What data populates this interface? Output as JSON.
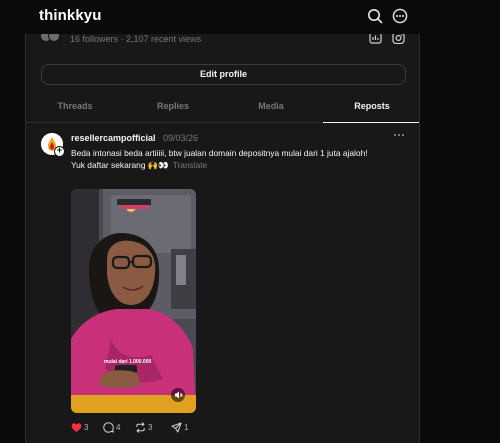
{
  "app": {
    "title": "thinkkyu"
  },
  "header": {
    "icons": [
      "search-icon",
      "more-circle-icon"
    ]
  },
  "profile": {
    "stats_text": "16 followers · 2,107 recent views",
    "edit_profile_label": "Edit profile",
    "social_icons": [
      "instagram-icon",
      "insights-icon"
    ]
  },
  "tabs": [
    {
      "label": "Threads",
      "active": false
    },
    {
      "label": "Replies",
      "active": false
    },
    {
      "label": "Media",
      "active": false
    },
    {
      "label": "Reposts",
      "active": true
    }
  ],
  "post": {
    "username": "resellercampofficial",
    "date": "09/03/26",
    "text_line1": "Beda intonasi beda artiiiii, btw jualan domain depositnya mulai dari 1 juta ajaloh!",
    "text_line2": "Yuk daftar sekarang 🙌👀",
    "translate_label": "Translate",
    "media_caption": "mulai dari 1.000.000",
    "likes": "3",
    "comments": "4",
    "reposts": "3",
    "shares": "1"
  },
  "colors": {
    "background": "#0a0a0a",
    "panel": "#181818",
    "border": "#2d2d2d",
    "text_primary": "#f3f5f7",
    "text_secondary": "#777777",
    "like_red": "#ff3040"
  }
}
